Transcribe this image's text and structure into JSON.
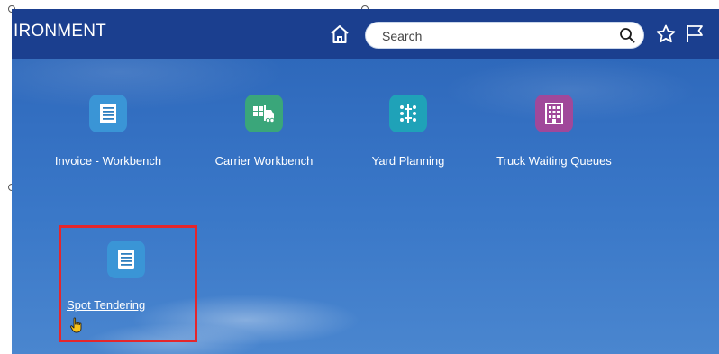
{
  "header": {
    "title": "IRONMENT",
    "search": {
      "placeholder": "Search",
      "value": ""
    },
    "icons": [
      "home-icon",
      "search-icon",
      "star-icon",
      "flag-icon"
    ]
  },
  "tiles": [
    {
      "label": "Invoice - Workbench",
      "icon": "document-icon",
      "color": "#3a95d6"
    },
    {
      "label": "Carrier Workbench",
      "icon": "forklift-icon",
      "color": "#3aa67a"
    },
    {
      "label": "Yard Planning",
      "icon": "yard-grid-icon",
      "color": "#1fa2b8"
    },
    {
      "label": "Truck Waiting Queues",
      "icon": "building-icon",
      "color": "#a0489a"
    },
    {
      "label": "Spot Tendering",
      "icon": "document-icon",
      "color": "#3a95d6",
      "highlighted": true
    }
  ],
  "colors": {
    "header": "#1b3f8f",
    "highlight_border": "#e5262b"
  }
}
